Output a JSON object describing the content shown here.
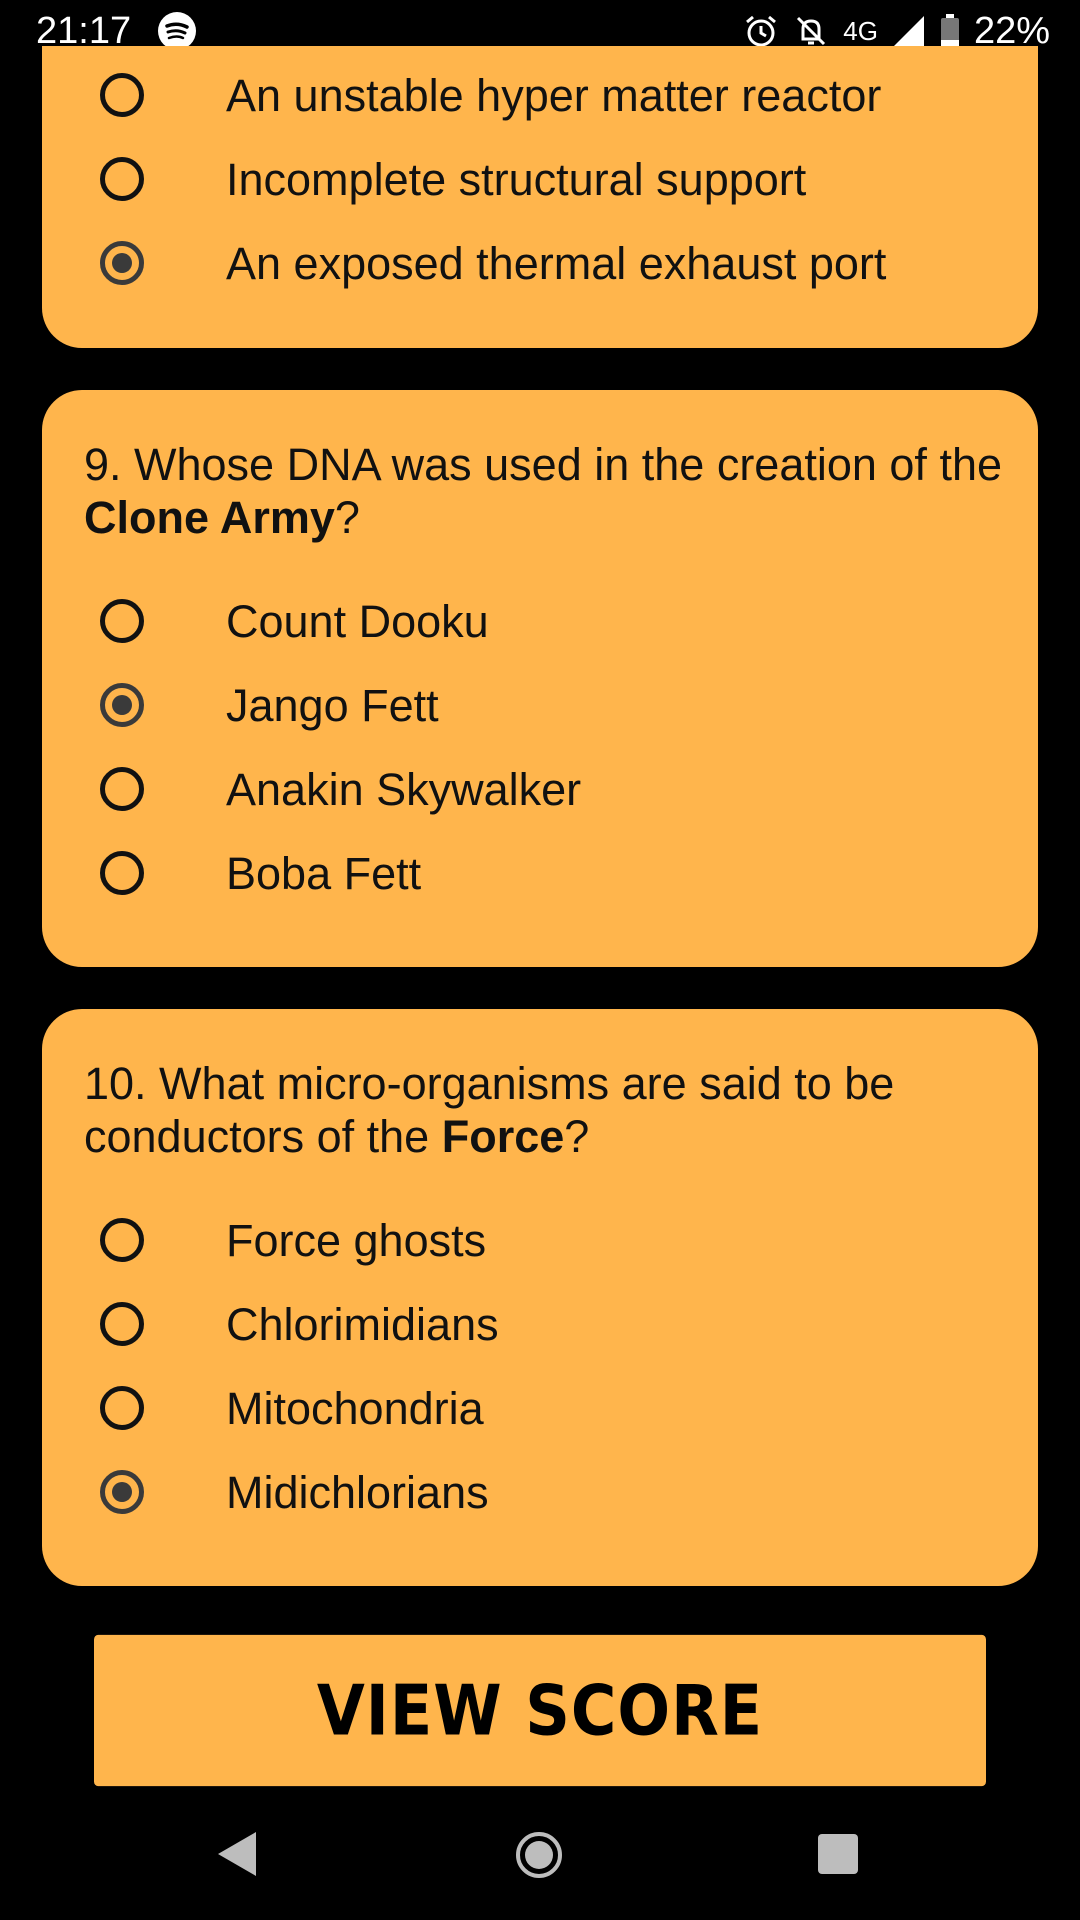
{
  "status_bar": {
    "time": "21:17",
    "network": "4G",
    "battery": "22%",
    "icons": [
      "spotify-icon",
      "alarm-icon",
      "notifications-off-icon",
      "signal-icon",
      "battery-icon"
    ]
  },
  "card_top": {
    "options": [
      {
        "label": "An unstable hyper matter reactor",
        "selected": false
      },
      {
        "label": "Incomplete structural support",
        "selected": false
      },
      {
        "label": "An exposed thermal exhaust port",
        "selected": true
      }
    ]
  },
  "q9": {
    "question_prefix": "9. Whose DNA was used in the creation of the ",
    "question_bold": "Clone Army",
    "question_suffix": "?",
    "options": [
      {
        "label": "Count Dooku",
        "selected": false
      },
      {
        "label": "Jango Fett",
        "selected": true
      },
      {
        "label": "Anakin Skywalker",
        "selected": false
      },
      {
        "label": "Boba Fett",
        "selected": false
      }
    ]
  },
  "q10": {
    "question_prefix": "10. What micro-organisms are said to be conductors of the ",
    "question_bold": "Force",
    "question_suffix": "?",
    "options": [
      {
        "label": "Force ghosts",
        "selected": false
      },
      {
        "label": "Chlorimidians",
        "selected": false
      },
      {
        "label": "Mitochondria",
        "selected": false
      },
      {
        "label": "Midichlorians",
        "selected": true
      }
    ]
  },
  "view_score_label": "VIEW SCORE",
  "colors": {
    "card": "#FFB54C",
    "background": "#000000",
    "text": "#111111",
    "radio_selected": "#3a3a3a"
  }
}
